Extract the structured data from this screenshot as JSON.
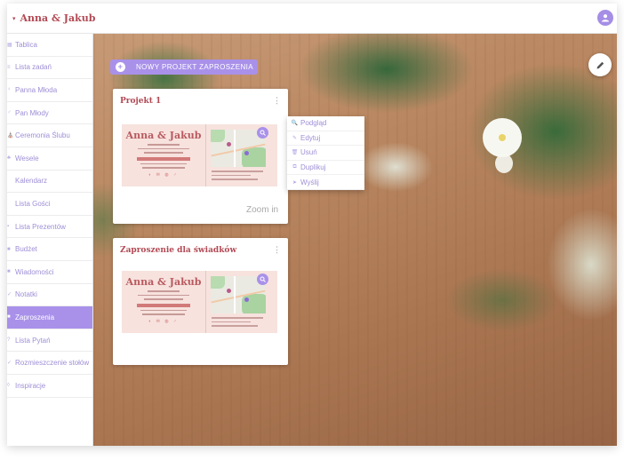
{
  "header": {
    "brand_mark": "▾",
    "brand": "Anna & Jakub",
    "avatar_icon": "person-icon"
  },
  "sidebar": {
    "items": [
      {
        "icon": "▦",
        "label": "Tablica",
        "active": false
      },
      {
        "icon": "≡",
        "label": "Lista zadań",
        "active": false
      },
      {
        "icon": "♀",
        "label": "Panna Młoda",
        "active": false
      },
      {
        "icon": "♂",
        "label": "Pan Młody",
        "active": false
      },
      {
        "icon": "⛪",
        "label": "Ceremonia Ślubu",
        "active": false
      },
      {
        "icon": "♣",
        "label": "Wesele",
        "active": false
      },
      {
        "icon": "",
        "label": "Kalendarz",
        "active": false
      },
      {
        "icon": "",
        "label": "Lista Gości",
        "active": false
      },
      {
        "icon": "▪",
        "label": "Lista Prezentów",
        "active": false
      },
      {
        "icon": "■",
        "label": "Budżet",
        "active": false
      },
      {
        "icon": "■",
        "label": "Wiadomości",
        "active": false
      },
      {
        "icon": "✓",
        "label": "Notatki",
        "active": false
      },
      {
        "icon": "■",
        "label": "Zaproszenia",
        "active": true
      },
      {
        "icon": "?",
        "label": "Lista Pytań",
        "active": false
      },
      {
        "icon": "✓",
        "label": "Rozmieszczenie stołów",
        "active": false
      },
      {
        "icon": "◊",
        "label": "Inspiracje",
        "active": false
      }
    ]
  },
  "main": {
    "new_button": "NOWY PROJEKT ZAPROSZENIA",
    "zoom_label": "Zoom in",
    "projects": [
      {
        "title": "Projekt 1",
        "kebab": "⋮",
        "preview": {
          "names": "Anna & Jakub",
          "icons": "◐ ✉ ◍ ♂"
        }
      },
      {
        "title": "Zaproszenie dla świadków",
        "kebab": "⋮",
        "preview": {
          "names": "Anna & Jakub",
          "icons": "◐ ✉ ◍ ♂"
        }
      }
    ],
    "menu": [
      {
        "icon": "🔍",
        "label": "Podgląd"
      },
      {
        "icon": "✎",
        "label": "Edytuj"
      },
      {
        "icon": "🗑",
        "label": "Usuń"
      },
      {
        "icon": "⧉",
        "label": "Duplikuj"
      },
      {
        "icon": "➤",
        "label": "Wyślij"
      }
    ]
  },
  "colors": {
    "accent": "#a991ea",
    "brand": "#b24a55",
    "menu_text": "#9f8fd6"
  }
}
